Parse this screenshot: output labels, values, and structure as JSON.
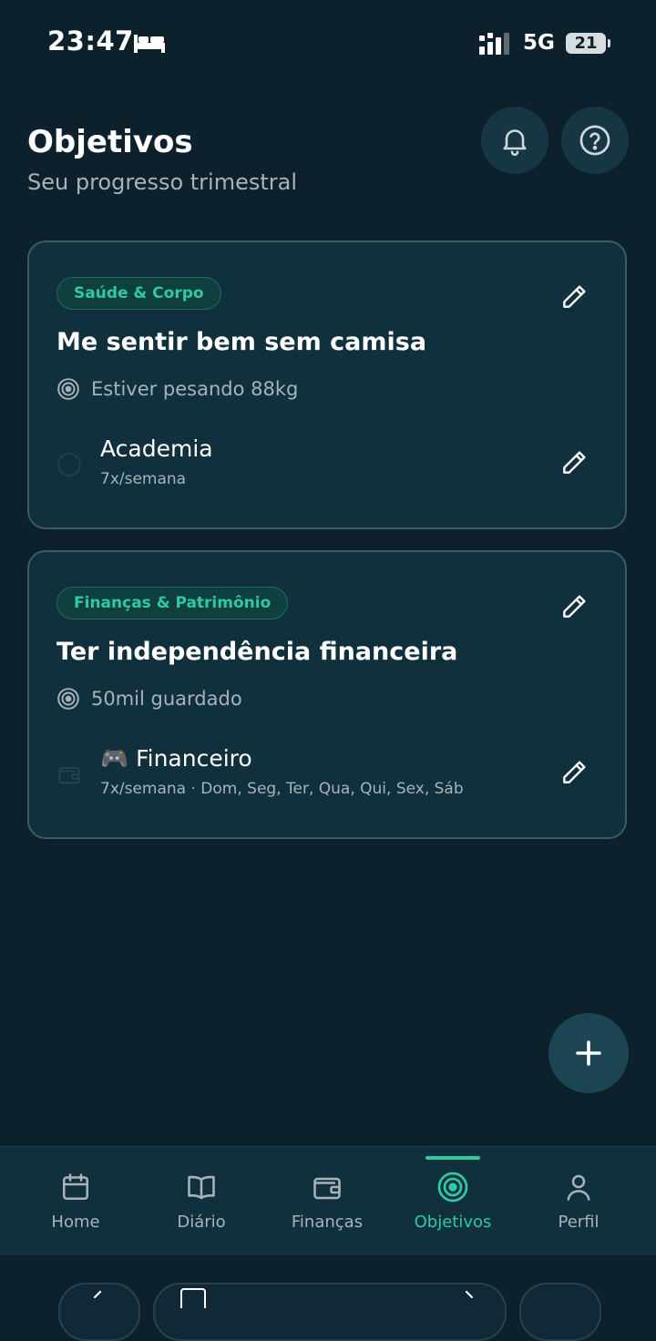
{
  "status_bar": {
    "time": "23:47",
    "network": "5G",
    "battery": "21"
  },
  "header": {
    "title": "Objetivos",
    "subtitle": "Seu progresso trimestral"
  },
  "goals": [
    {
      "category": "Saúde & Corpo",
      "title": "Me sentir bem sem camisa",
      "target": "Estiver pesando 88kg",
      "habit": {
        "name": "Academia",
        "frequency": "7x/semana",
        "icon": "checkbox-circle-icon"
      }
    },
    {
      "category": "Finanças & Patrimônio",
      "title": "Ter independência financeira",
      "target": "50mil guardado",
      "habit": {
        "name": "🎮 Financeiro",
        "frequency": "7x/semana · Dom, Seg, Ter, Qua, Qui, Sex, Sáb",
        "icon": "wallet-icon"
      }
    }
  ],
  "bottom_nav": {
    "items": [
      {
        "label": "Home",
        "icon": "calendar-icon"
      },
      {
        "label": "Diário",
        "icon": "book-icon"
      },
      {
        "label": "Finanças",
        "icon": "wallet-icon"
      },
      {
        "label": "Objetivos",
        "icon": "target-icon"
      },
      {
        "label": "Perfil",
        "icon": "user-icon"
      }
    ],
    "active": "Objetivos"
  },
  "colors": {
    "background": "#0c212b",
    "card": "#11303d",
    "accent": "#2fcaa0",
    "muted_text": "#a7b3b9"
  }
}
